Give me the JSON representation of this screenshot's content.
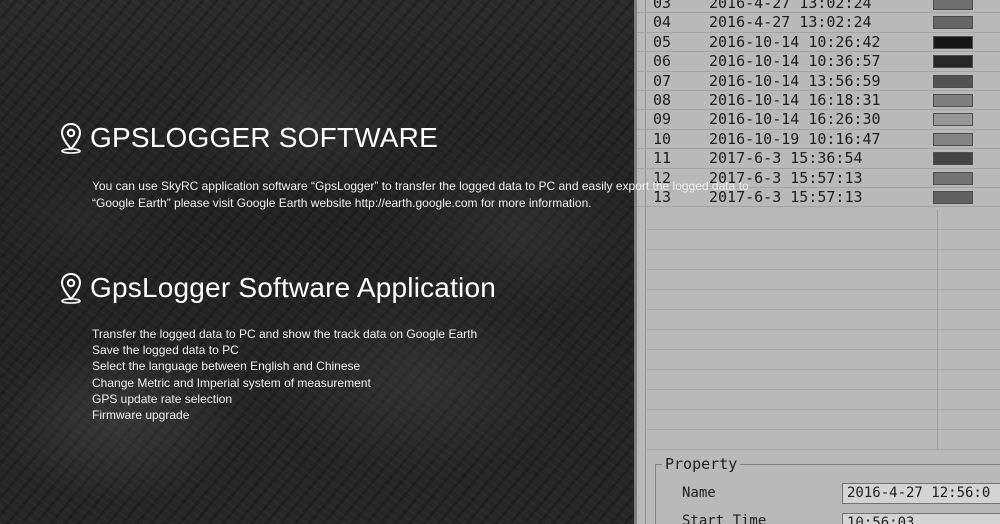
{
  "section1": {
    "title": "GPSLOGGER SOFTWARE",
    "line1": "You can use SkyRC application software “GpsLogger” to transfer the logged data to PC and easily export the logged data to",
    "line2": "“Google Earth” please visit Google Earth website http://earth.google.com for more information."
  },
  "section2": {
    "title": "GpsLogger Software Application",
    "features": [
      "Transfer the logged data to PC and show the track data on Google Earth",
      "Save the logged data to PC",
      "Select the language between English and Chinese",
      "Change Metric and Imperial system of measurement",
      "GPS update rate selection",
      "Firmware upgrade"
    ]
  },
  "icons": {
    "section_icon": "location-pin-icon"
  },
  "screenshot": {
    "log_rows": [
      {
        "idx": "03",
        "datetime": "2016-4-27 13:02:24",
        "color": "#7a7a7a"
      },
      {
        "idx": "04",
        "datetime": "2016-4-27 13:02:24",
        "color": "#6e6e6e"
      },
      {
        "idx": "05",
        "datetime": "2016-10-14 10:26:42",
        "color": "#1a1a1a"
      },
      {
        "idx": "06",
        "datetime": "2016-10-14 10:36:57",
        "color": "#2a2a2a"
      },
      {
        "idx": "07",
        "datetime": "2016-10-14 13:56:59",
        "color": "#5a5a5a"
      },
      {
        "idx": "08",
        "datetime": "2016-10-14 16:18:31",
        "color": "#8a8a8a"
      },
      {
        "idx": "09",
        "datetime": "2016-10-14 16:26:30",
        "color": "#a5a5a5"
      },
      {
        "idx": "10",
        "datetime": "2016-10-19 10:16:47",
        "color": "#8f8f8f"
      },
      {
        "idx": "11",
        "datetime": "2017-6-3 15:36:54",
        "color": "#4a4a4a"
      },
      {
        "idx": "12",
        "datetime": "2017-6-3 15:57:13",
        "color": "#7d7d7d"
      },
      {
        "idx": "13",
        "datetime": "2017-6-3 15:57:13",
        "color": "#6a6a6a"
      }
    ],
    "property": {
      "legend": "Property",
      "name_label": "Name",
      "name_value": "2016-4-27 12:56:0",
      "start_label": "Start Time",
      "start_value": "10:56:03"
    }
  }
}
